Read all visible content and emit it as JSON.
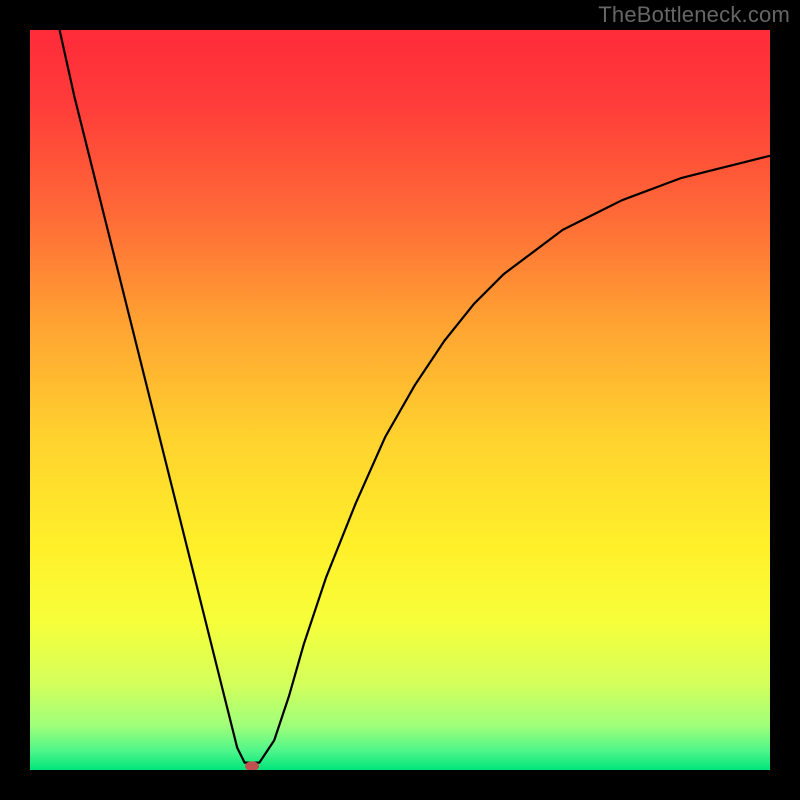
{
  "watermark": "TheBottleneck.com",
  "chart_data": {
    "type": "line",
    "title": "",
    "xlabel": "",
    "ylabel": "",
    "xlim": [
      0,
      100
    ],
    "ylim": [
      0,
      100
    ],
    "background_gradient": {
      "stops": [
        {
          "offset": 0.0,
          "color": "#ff2b3a"
        },
        {
          "offset": 0.1,
          "color": "#ff3c3a"
        },
        {
          "offset": 0.25,
          "color": "#ff6a37"
        },
        {
          "offset": 0.4,
          "color": "#ffa432"
        },
        {
          "offset": 0.55,
          "color": "#ffd22e"
        },
        {
          "offset": 0.7,
          "color": "#fff02a"
        },
        {
          "offset": 0.8,
          "color": "#f6ff3a"
        },
        {
          "offset": 0.88,
          "color": "#d6ff5a"
        },
        {
          "offset": 0.94,
          "color": "#a0ff7a"
        },
        {
          "offset": 0.975,
          "color": "#4cf58a"
        },
        {
          "offset": 1.0,
          "color": "#00e57a"
        }
      ]
    },
    "series": [
      {
        "name": "bottleneck-curve",
        "color": "#000000",
        "x": [
          4,
          6,
          8,
          10,
          12,
          14,
          16,
          18,
          20,
          22,
          24,
          26,
          27,
          28,
          29,
          30,
          31,
          33,
          35,
          37,
          40,
          44,
          48,
          52,
          56,
          60,
          64,
          68,
          72,
          76,
          80,
          84,
          88,
          92,
          96,
          100
        ],
        "y": [
          100,
          91,
          83,
          75,
          67,
          59,
          51,
          43,
          35,
          27,
          19,
          11,
          7,
          3,
          1,
          1,
          1,
          4,
          10,
          17,
          26,
          36,
          45,
          52,
          58,
          63,
          67,
          70,
          73,
          75,
          77,
          78.5,
          80,
          81,
          82,
          83
        ]
      }
    ],
    "marker": {
      "name": "optimal-point",
      "x": 30,
      "y": 0.5,
      "color": "#c05050",
      "rx": 7,
      "ry": 5
    }
  }
}
